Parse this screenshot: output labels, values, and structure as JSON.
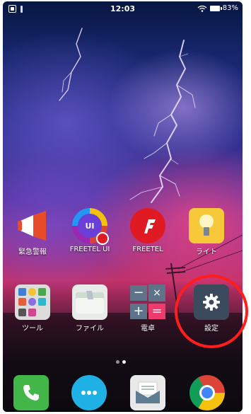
{
  "status_bar": {
    "time": "12:03",
    "battery": "83%",
    "icons": [
      "screenshot-icon",
      "info-icon",
      "wifi-icon",
      "battery-icon"
    ]
  },
  "apps_row1": [
    {
      "label": "緊急警報",
      "icon": "megaphone-icon",
      "color": "#e94c2a"
    },
    {
      "label": "FREETEL UI",
      "icon": "freetel-ui-icon",
      "color": "#6a3fd8"
    },
    {
      "label": "FREETEL",
      "icon": "freetel-icon",
      "color": "#e01a22"
    },
    {
      "label": "ライト",
      "icon": "flashlight-icon",
      "color": "#f7c93a"
    }
  ],
  "apps_row2": [
    {
      "label": "ツール",
      "icon": "tools-folder-icon",
      "color": "#dcdcdc"
    },
    {
      "label": "ファイル",
      "icon": "files-icon",
      "color": "#e8ece8"
    },
    {
      "label": "電卓",
      "icon": "calculator-icon",
      "color": "#5f7388"
    },
    {
      "label": "設定",
      "icon": "gear-icon",
      "color": "#3b4a5c"
    }
  ],
  "dock": [
    {
      "name": "phone-app",
      "icon": "phone-icon",
      "color": "#43b649"
    },
    {
      "name": "messages-app",
      "icon": "chat-icon",
      "color": "#1fb1e6"
    },
    {
      "name": "email-app",
      "icon": "envelope-icon",
      "color": "#e9e9e9"
    },
    {
      "name": "chrome-app",
      "icon": "chrome-icon",
      "color": "#db4437"
    }
  ],
  "page_indicator": {
    "pages": 2,
    "current": 1
  },
  "highlight": {
    "target": "settings-app",
    "color": "#ff1d1d"
  }
}
